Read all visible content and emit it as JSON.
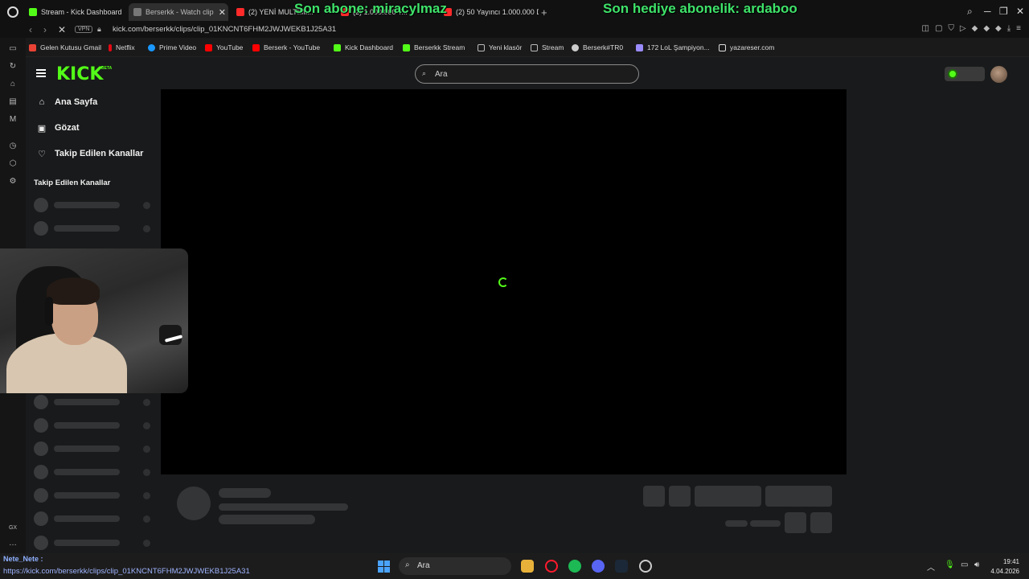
{
  "browser": {
    "tabs": [
      {
        "title": "Stream - Kick Dashboard",
        "favicon_color": "#53fc18",
        "active": false
      },
      {
        "title": "Berserkk - Watch clip",
        "favicon_color": "#777777",
        "active": true
      },
      {
        "title": "(2) YENİ MULTİMİ...",
        "favicon_color": "#ff2a2a",
        "active": false
      },
      {
        "title": "(2) 1.000.000 T...",
        "favicon_color": "#ff2a2a",
        "active": false
      },
      {
        "title": "(2) 50 Yayıncı 1.000.000 D",
        "favicon_color": "#ff2a2a",
        "active": false
      }
    ],
    "url": "kick.com/berserkk/clips/clip_01KNCNT6FHM2JWJWEKB1J25A31",
    "vpn_label": "VPN"
  },
  "overlay": {
    "last_sub": "Son abone: miracylmaz",
    "last_gift": "Son hediye abonelik: ardaboo"
  },
  "bookmarks": [
    {
      "label": "Gelen Kutusu Gmail",
      "color": "#ea4335"
    },
    {
      "label": "Netflix",
      "color": "#e50914"
    },
    {
      "label": "Prime Video",
      "color": "#1a98ff"
    },
    {
      "label": "YouTube",
      "color": "#ff0000"
    },
    {
      "label": "Berserk - YouTube",
      "color": "#ff0000"
    },
    {
      "label": "Kick Dashboard",
      "color": "#53fc18"
    },
    {
      "label": "Berserkk Stream",
      "color": "#53fc18"
    },
    {
      "label": "Yeni klasör",
      "color": "#bbbbbb"
    },
    {
      "label": "Stream",
      "color": "#bbbbbb"
    },
    {
      "label": "Berserk#TR0",
      "color": "#cccccc"
    },
    {
      "label": "172 LoL Şampiyon...",
      "color": "#9a8cff"
    },
    {
      "label": "yazareser.com",
      "color": "#dddddd"
    }
  ],
  "kick": {
    "logo": "KICK",
    "beta": "BETA",
    "search_placeholder": "Ara",
    "nav": [
      {
        "label": "Ana Sayfa",
        "icon": "home-icon"
      },
      {
        "label": "Gözat",
        "icon": "browse-icon"
      },
      {
        "label": "Takip Edilen Kanallar",
        "icon": "heart-icon"
      }
    ],
    "following_title": "Takip Edilen Kanallar",
    "accent": "#53fc18"
  },
  "statusbar": {
    "chat_user": "Nete_Nete :",
    "hover_url": "https://kick.com/berserkk/clips/clip_01KNCNT6FHM2JWJWEKB1J25A31"
  },
  "taskbar": {
    "search": "Ara",
    "time": "19:41",
    "date": "4.04.2026"
  },
  "rail": {
    "gx_label": "GX"
  }
}
